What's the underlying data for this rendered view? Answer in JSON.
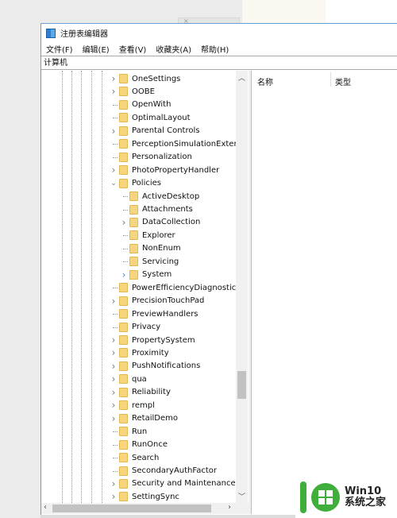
{
  "window": {
    "title": "注册表编辑器",
    "address": "计算机"
  },
  "menu": [
    "文件(F)",
    "编辑(E)",
    "查看(V)",
    "收藏夹(A)",
    "帮助(H)"
  ],
  "tree": [
    {
      "label": "OneSettings",
      "level": 0,
      "expander": "collapsed"
    },
    {
      "label": "OOBE",
      "level": 0,
      "expander": "collapsed"
    },
    {
      "label": "OpenWith",
      "level": 0,
      "expander": "none"
    },
    {
      "label": "OptimalLayout",
      "level": 0,
      "expander": "none"
    },
    {
      "label": "Parental Controls",
      "level": 0,
      "expander": "collapsed"
    },
    {
      "label": "PerceptionSimulationExtens",
      "level": 0,
      "expander": "none"
    },
    {
      "label": "Personalization",
      "level": 0,
      "expander": "none"
    },
    {
      "label": "PhotoPropertyHandler",
      "level": 0,
      "expander": "collapsed"
    },
    {
      "label": "Policies",
      "level": 0,
      "expander": "expanded"
    },
    {
      "label": "ActiveDesktop",
      "level": 1,
      "expander": "none"
    },
    {
      "label": "Attachments",
      "level": 1,
      "expander": "none"
    },
    {
      "label": "DataCollection",
      "level": 1,
      "expander": "collapsed"
    },
    {
      "label": "Explorer",
      "level": 1,
      "expander": "none"
    },
    {
      "label": "NonEnum",
      "level": 1,
      "expander": "none"
    },
    {
      "label": "Servicing",
      "level": 1,
      "expander": "none"
    },
    {
      "label": "System",
      "level": 1,
      "expander": "collapsed-hover"
    },
    {
      "label": "PowerEfficiencyDiagnostics",
      "level": 0,
      "expander": "none"
    },
    {
      "label": "PrecisionTouchPad",
      "level": 0,
      "expander": "collapsed"
    },
    {
      "label": "PreviewHandlers",
      "level": 0,
      "expander": "none"
    },
    {
      "label": "Privacy",
      "level": 0,
      "expander": "none"
    },
    {
      "label": "PropertySystem",
      "level": 0,
      "expander": "collapsed"
    },
    {
      "label": "Proximity",
      "level": 0,
      "expander": "collapsed"
    },
    {
      "label": "PushNotifications",
      "level": 0,
      "expander": "collapsed"
    },
    {
      "label": "qua",
      "level": 0,
      "expander": "collapsed"
    },
    {
      "label": "Reliability",
      "level": 0,
      "expander": "collapsed"
    },
    {
      "label": "rempl",
      "level": 0,
      "expander": "collapsed"
    },
    {
      "label": "RetailDemo",
      "level": 0,
      "expander": "collapsed"
    },
    {
      "label": "Run",
      "level": 0,
      "expander": "none"
    },
    {
      "label": "RunOnce",
      "level": 0,
      "expander": "none"
    },
    {
      "label": "Search",
      "level": 0,
      "expander": "none"
    },
    {
      "label": "SecondaryAuthFactor",
      "level": 0,
      "expander": "none"
    },
    {
      "label": "Security and Maintenance",
      "level": 0,
      "expander": "collapsed"
    },
    {
      "label": "SettingSync",
      "level": 0,
      "expander": "collapsed"
    }
  ],
  "columns": {
    "name": "名称",
    "type": "类型"
  },
  "watermark": {
    "line1": "Win10",
    "line2": "系统之家"
  },
  "colors": {
    "folder": "#f6d57e",
    "accent": "#3fae3a",
    "window_border": "#6a9fd4"
  }
}
